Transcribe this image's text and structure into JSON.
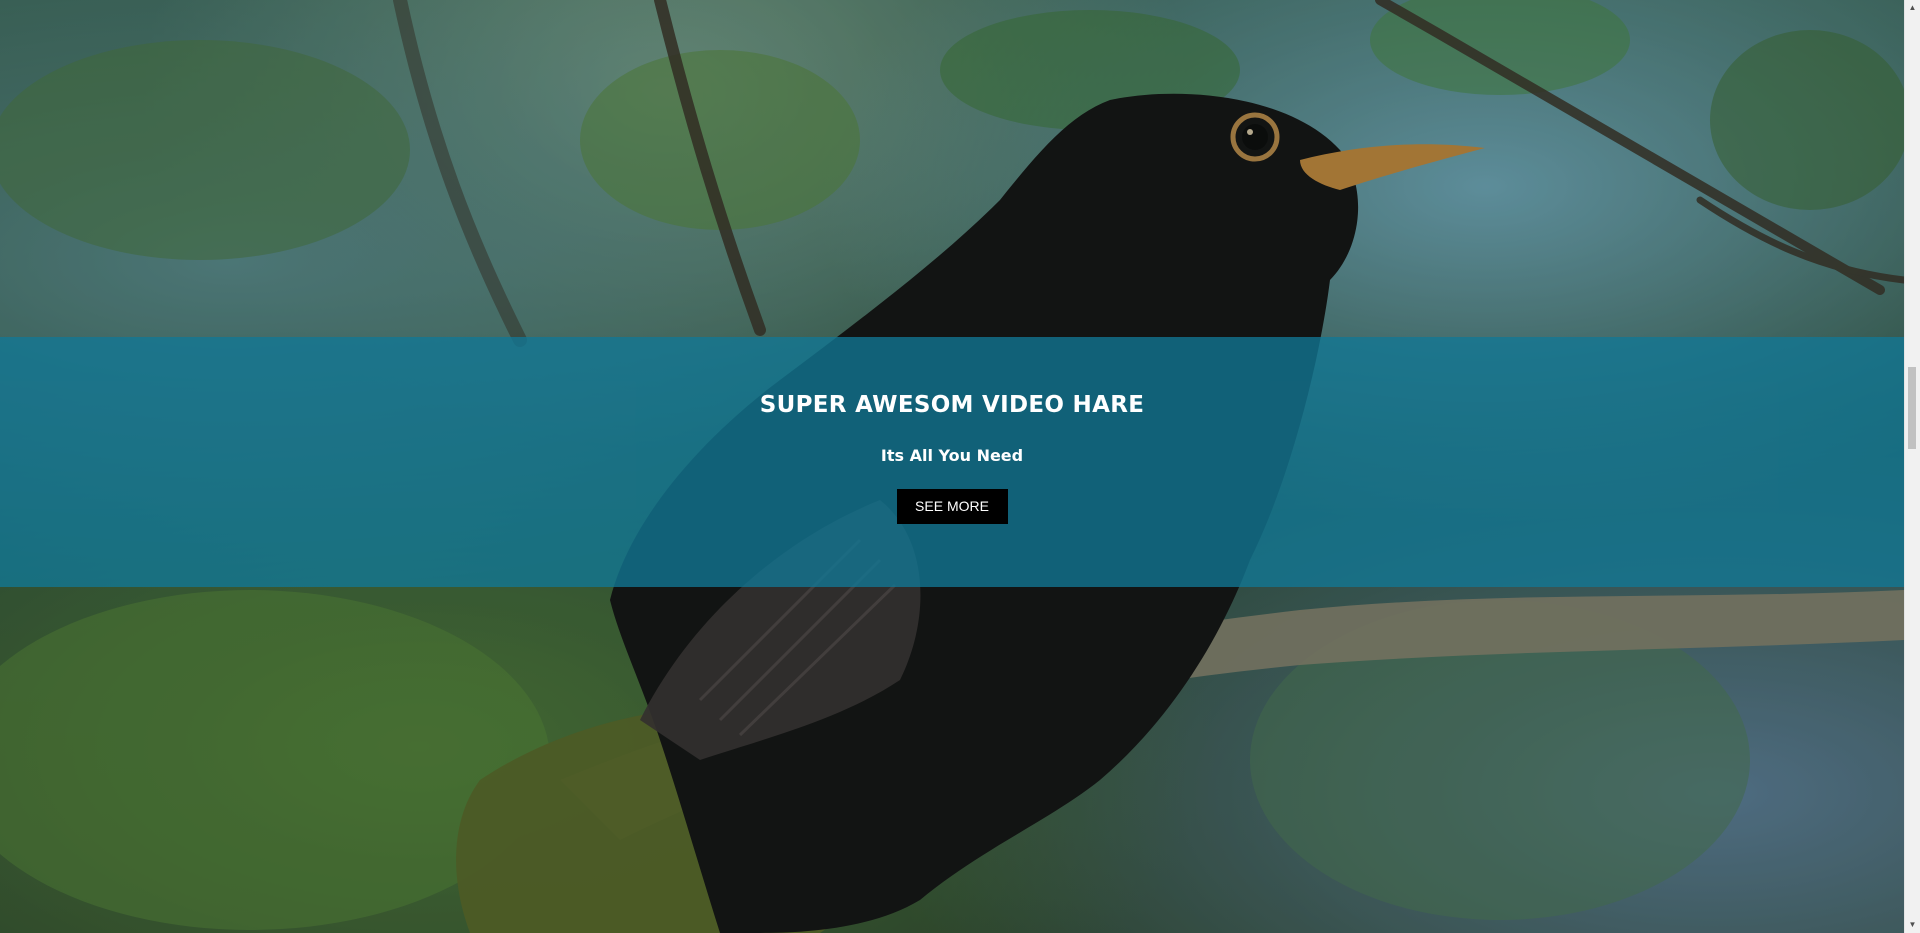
{
  "banner": {
    "title": "SUPER AWESOM VIDEO HARE",
    "subtitle": "Its All You Need",
    "button_label": "SEE MORE",
    "overlay_color": "#1278a0"
  },
  "scrollbar": {
    "up_arrow": "▲",
    "down_arrow": "▼"
  },
  "colors": {
    "button_bg": "#000000",
    "text": "#ffffff"
  }
}
